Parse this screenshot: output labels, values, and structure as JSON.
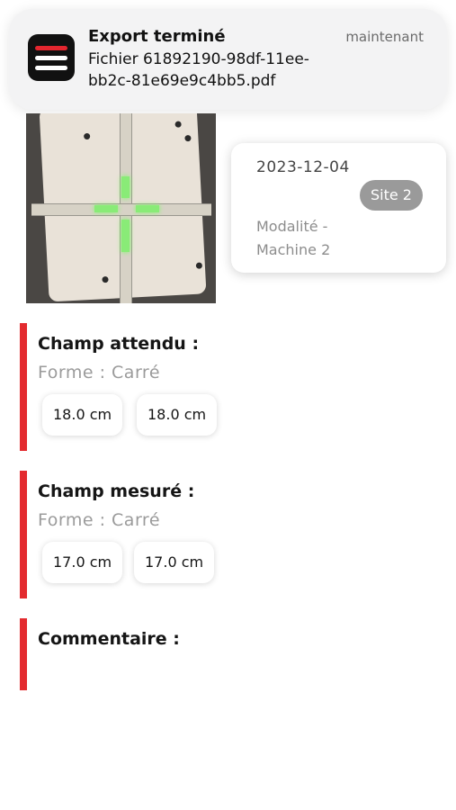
{
  "notification": {
    "app_icon": "app-logo-icon",
    "title": "Export terminé",
    "time": "maintenant",
    "body_line1": "Fichier 61892190-98df-11ee-",
    "body_line2": "bb2c-81e69e9c4bb5.pdf"
  },
  "info": {
    "date": "2023-12-04",
    "site": "Site 2",
    "modality": "Modalité  -",
    "machine": "Machine 2"
  },
  "expected": {
    "title": "Champ attendu :",
    "shape": "Forme : Carré",
    "dims": [
      "18.0 cm",
      "18.0 cm"
    ]
  },
  "measured": {
    "title": "Champ mesuré :",
    "shape": "Forme : Carré",
    "dims": [
      "17.0 cm",
      "17.0 cm"
    ]
  },
  "comment": {
    "title": "Commentaire :"
  },
  "colors": {
    "accent": "#e32b2f",
    "badge": "#9a9a9a"
  }
}
